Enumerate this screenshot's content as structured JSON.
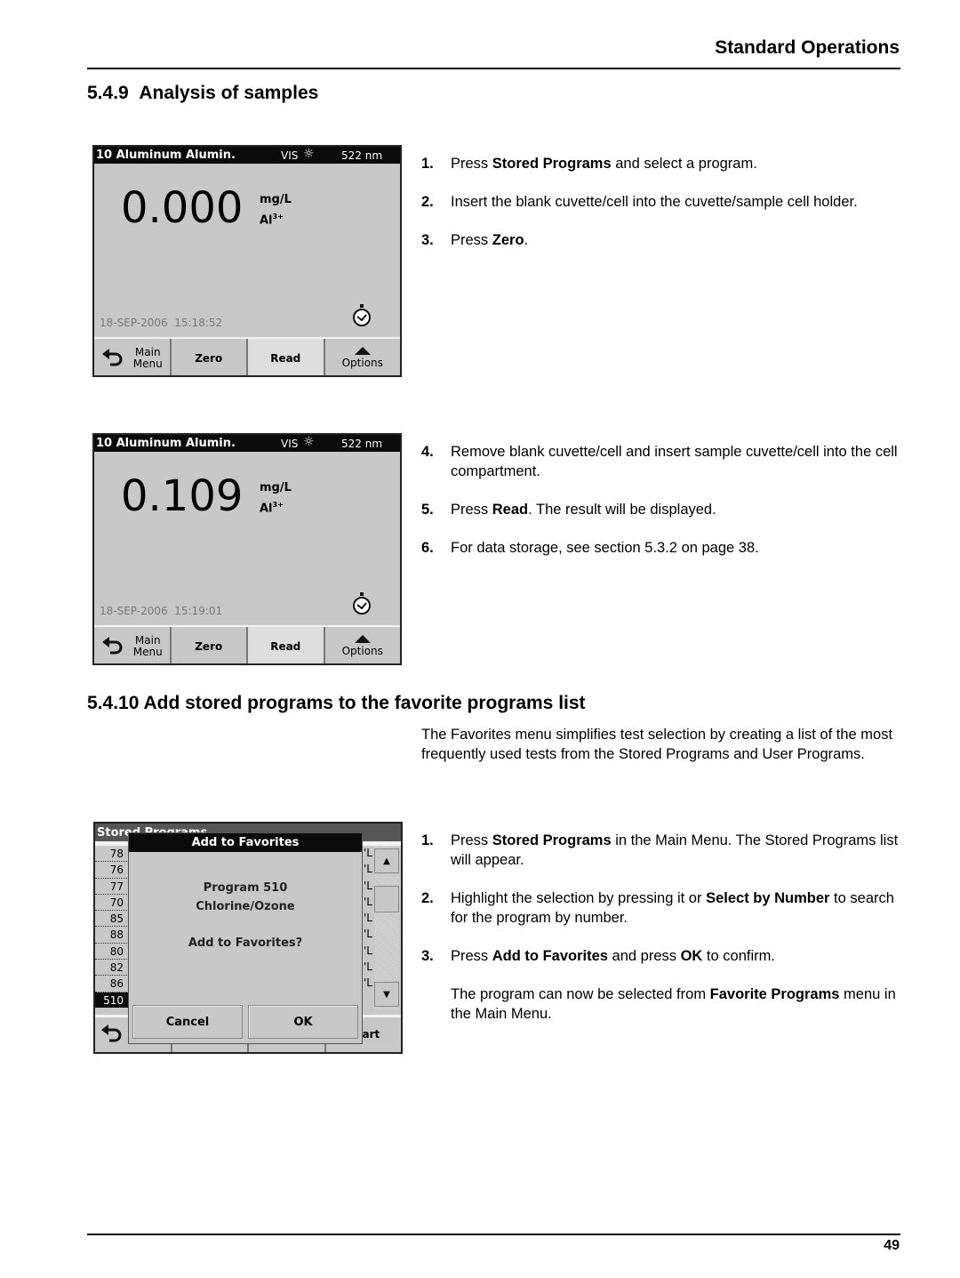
{
  "header": {
    "running_title": "Standard Operations"
  },
  "sections": [
    {
      "number": "5.4.9",
      "title": "Analysis of samples"
    },
    {
      "number": "5.4.10",
      "title": "Add stored programs to the favorite programs list"
    }
  ],
  "screens": {
    "blank": {
      "program": "10 Aluminum Alumin.",
      "mode": "VIS",
      "wavelength": "522 nm",
      "reading": "0.000",
      "unit": "mg/L",
      "species": "Al",
      "species_charge": "3+",
      "date": "18-SEP-2006",
      "time": "15:18:52",
      "buttons": {
        "main_line1": "Main",
        "main_line2": "Menu",
        "zero": "Zero",
        "read": "Read",
        "options": "Options"
      }
    },
    "sample": {
      "program": "10 Aluminum Alumin.",
      "mode": "VIS",
      "wavelength": "522 nm",
      "reading": "0.109",
      "unit": "mg/L",
      "species": "Al",
      "species_charge": "3+",
      "date": "18-SEP-2006",
      "time": "15:19:01",
      "buttons": {
        "main_line1": "Main",
        "main_line2": "Menu",
        "zero": "Zero",
        "read": "Read",
        "options": "Options"
      }
    },
    "favorites": {
      "title": "Stored Programs",
      "list": [
        "78",
        "76",
        "77",
        "70",
        "85",
        "88",
        "80",
        "82",
        "86",
        "510"
      ],
      "selected": "510",
      "list_tail": "'L",
      "bottom_partial": "art",
      "dialog": {
        "title": "Add to Favorites",
        "line1": "Program 510",
        "line2": "Chlorine/Ozone",
        "question": "Add to Favorites?",
        "cancel": "Cancel",
        "ok": "OK"
      }
    }
  },
  "analysis_steps": [
    {
      "n": "1.",
      "pre": "Press ",
      "bold": "Stored Programs",
      "post": " and select a program."
    },
    {
      "n": "2.",
      "pre": "Insert the blank cuvette/cell into the cuvette/sample cell holder.",
      "bold": "",
      "post": ""
    },
    {
      "n": "3.",
      "pre": "Press ",
      "bold": "Zero",
      "post": "."
    },
    {
      "n": "4.",
      "pre": "Remove blank cuvette/cell and insert sample cuvette/cell into the cell compartment.",
      "bold": "",
      "post": ""
    },
    {
      "n": "5.",
      "pre": "Press ",
      "bold": "Read",
      "post": ". The result will be displayed."
    },
    {
      "n": "6.",
      "pre": "For data storage, see section 5.3.2 on page 38.",
      "bold": "",
      "post": ""
    }
  ],
  "favorites_intro": "The Favorites menu simplifies test selection by creating a list of the most frequently used tests from the Stored Programs and User Programs.",
  "favorites_steps": [
    {
      "n": "1.",
      "pre": "Press ",
      "bold": "Stored Programs",
      "post": " in the Main Menu. The Stored Programs list will appear."
    },
    {
      "n": "2.",
      "pre": "Highlight the selection by pressing it or ",
      "bold": "Select by Number",
      "post": " to search for the program by number."
    },
    {
      "n": "3.",
      "pre": "Press ",
      "bold": "Add to Favorites",
      "post": " and press ",
      "bold2": "OK",
      "post2": " to confirm."
    }
  ],
  "favorites_note": {
    "pre": "The program can now be selected from ",
    "bold": "Favorite Programs",
    "post": " menu in the Main Menu."
  },
  "footer": {
    "page_number": "49"
  }
}
